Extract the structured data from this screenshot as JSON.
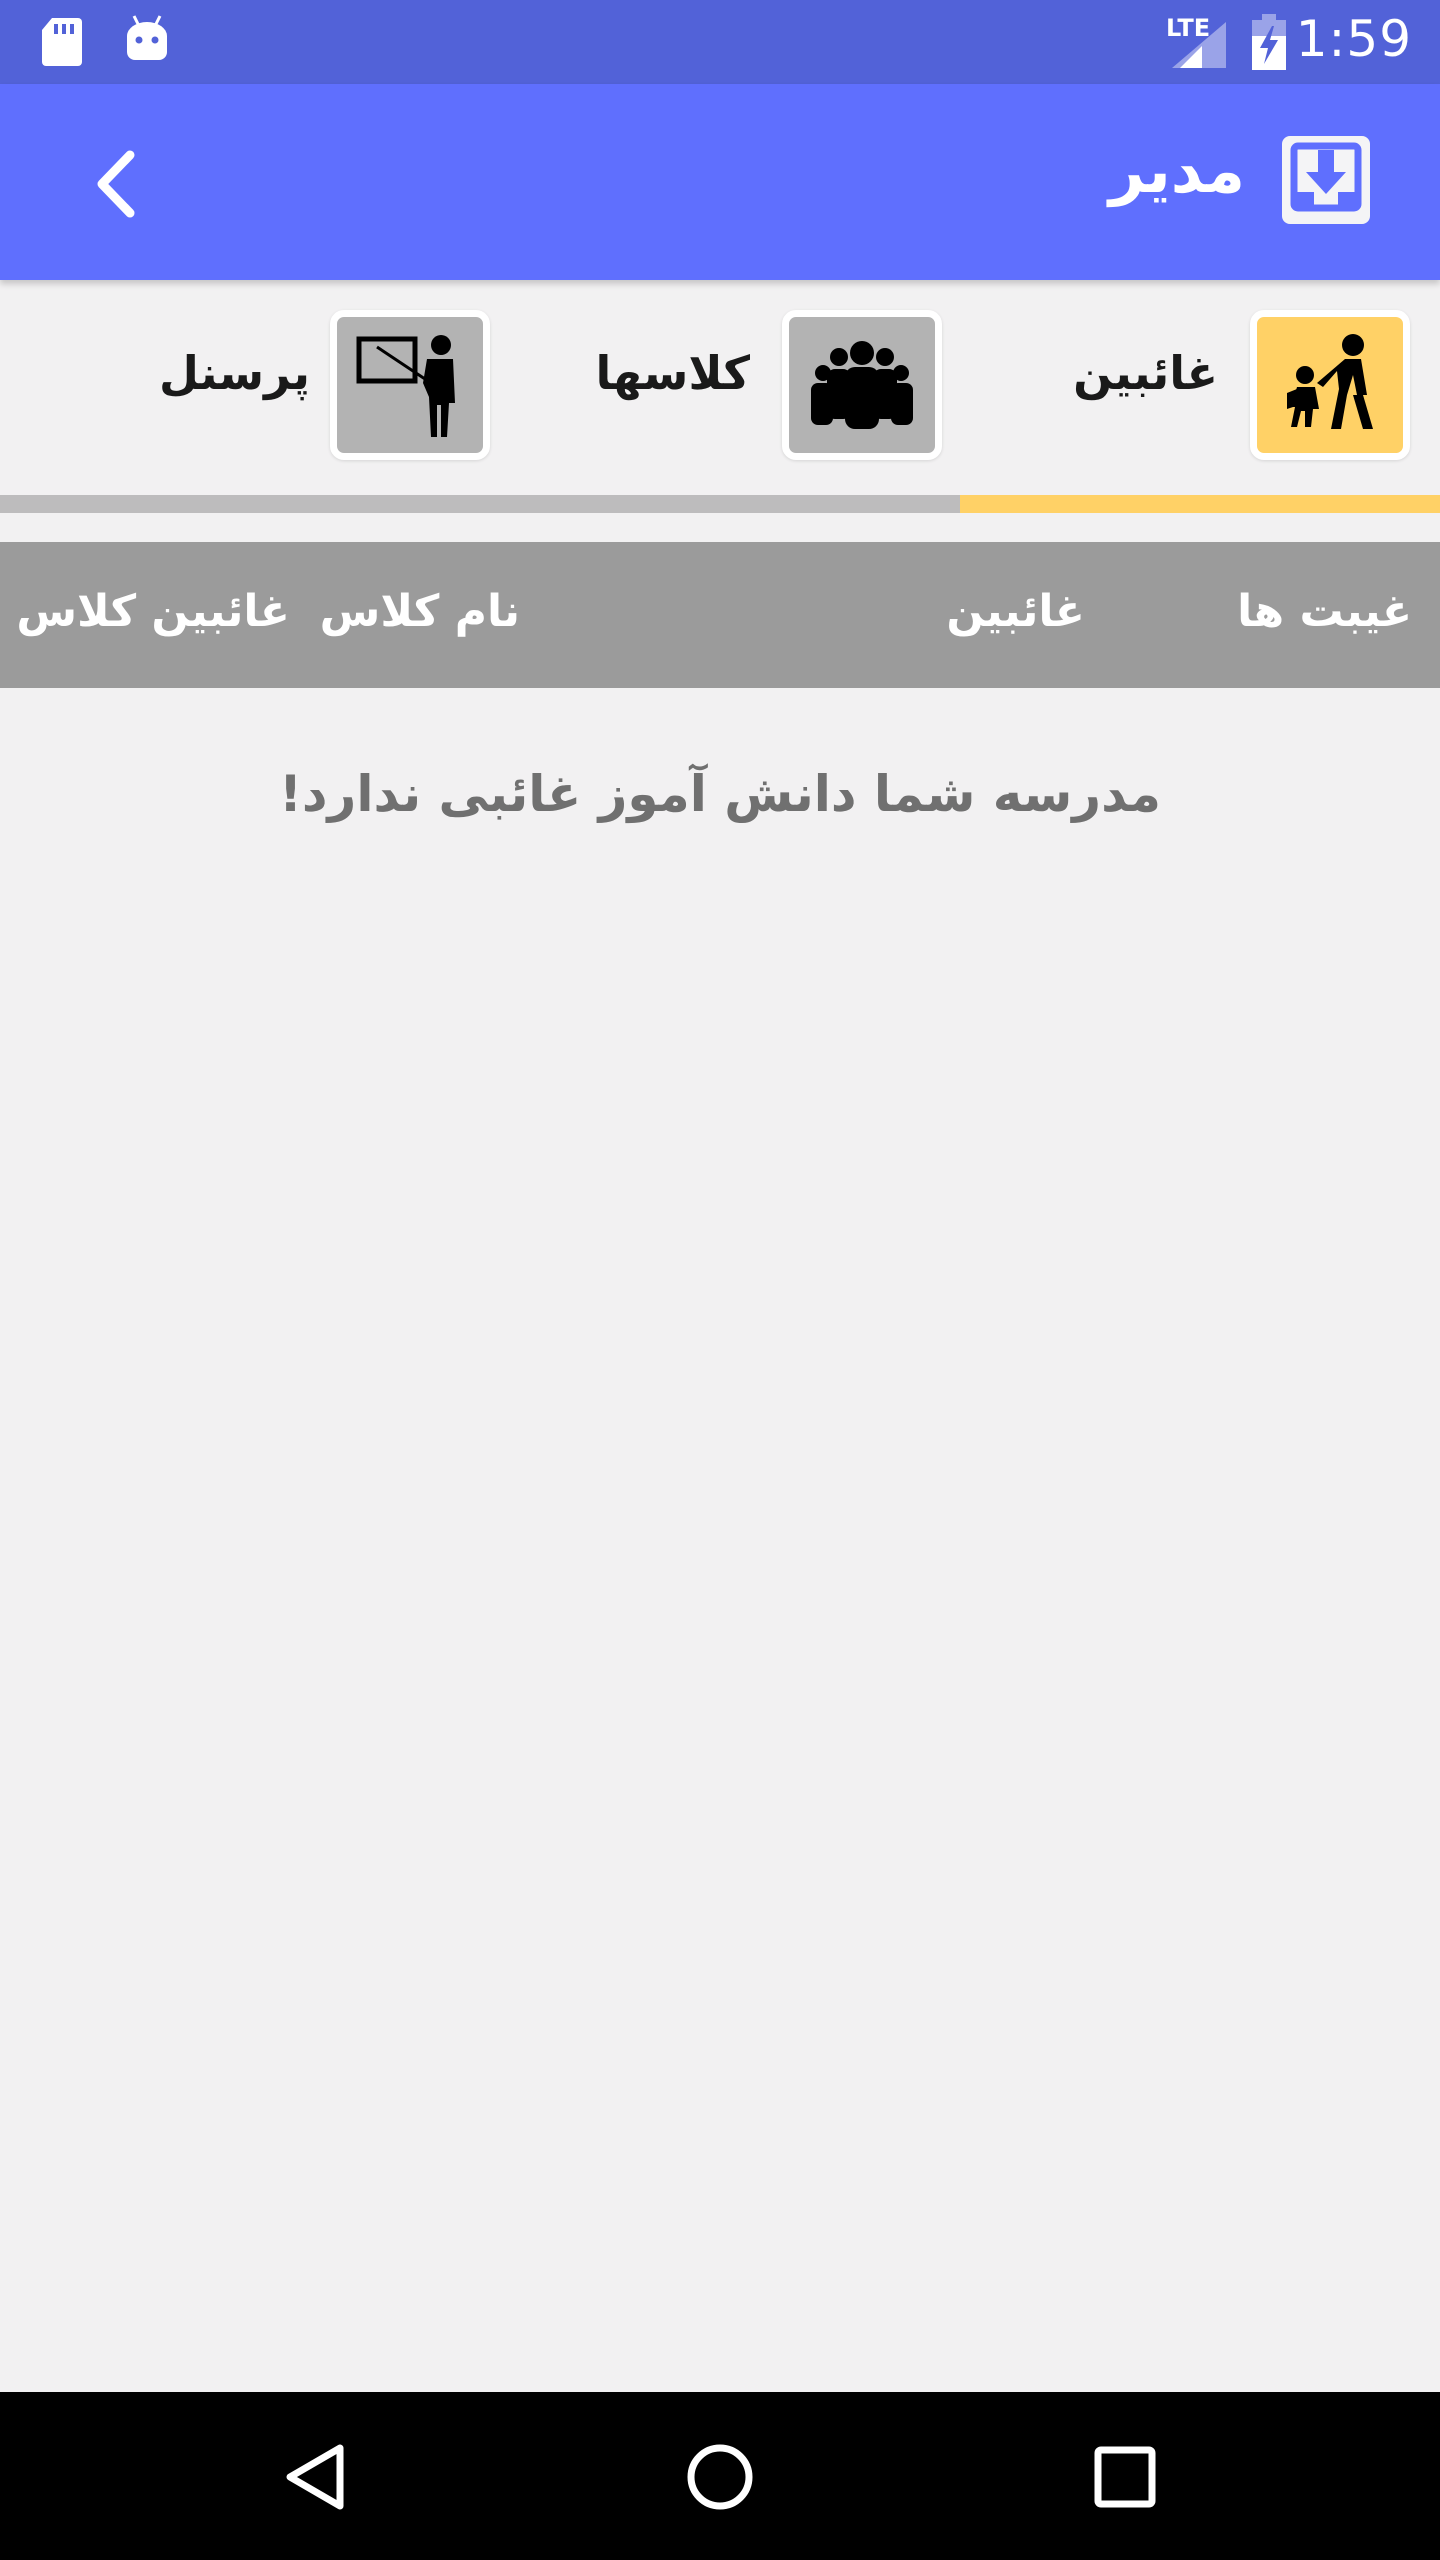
{
  "status_bar": {
    "time": "1:59",
    "network": "LTE",
    "icons": [
      "sd-card-icon",
      "android-icon",
      "lte-signal-icon",
      "battery-charging-icon"
    ]
  },
  "app_bar": {
    "title": "مدیر",
    "back_icon": "chevron-left-icon",
    "logo_icon": "download-box-icon"
  },
  "tabs": [
    {
      "label": "غائبین",
      "icon": "walking-children-icon",
      "active": true,
      "color": "#ffd166"
    },
    {
      "label": "کلاسها",
      "icon": "group-people-icon",
      "active": false,
      "color": "#b3b3b3"
    },
    {
      "label": "پرسنل",
      "icon": "teacher-board-icon",
      "active": false,
      "color": "#b3b3b3"
    }
  ],
  "table": {
    "headers": [
      "غیبت ها",
      "غائبین",
      "نام کلاس",
      "غائبین کلاس"
    ]
  },
  "empty_message": "مدرسه شما دانش آموز غائبی ندارد!",
  "nav": {
    "back_icon": "nav-back-icon",
    "home_icon": "nav-home-icon",
    "recents_icon": "nav-recents-icon"
  },
  "colors": {
    "status_bar": "#5262d8",
    "app_bar": "#5f6ffe",
    "accent": "#ffd166",
    "header": "#9b9b9b",
    "background": "#f2f1f2"
  }
}
